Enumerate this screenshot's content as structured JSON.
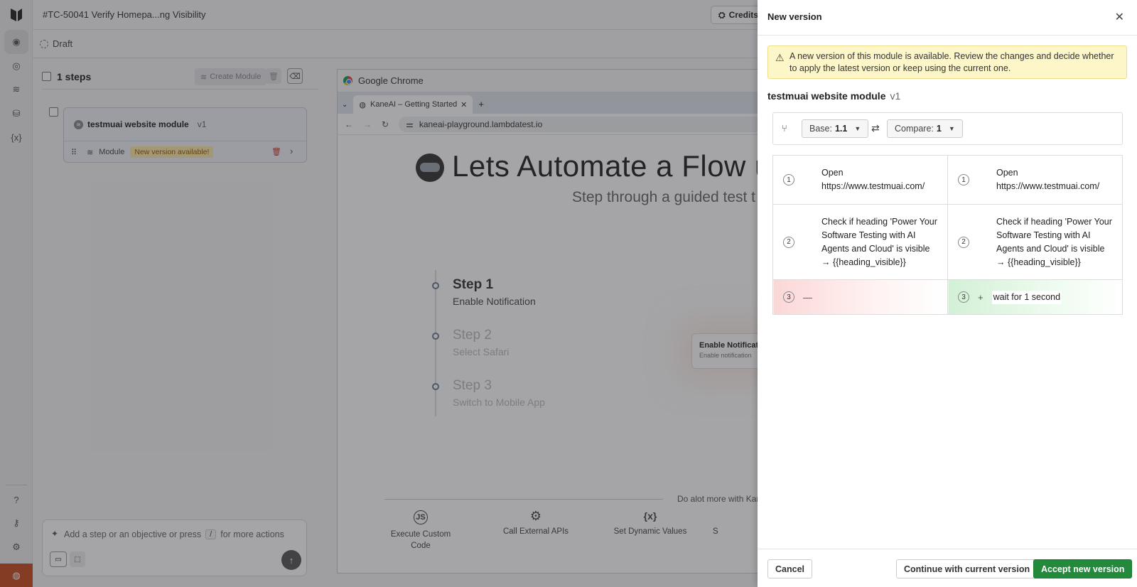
{
  "topbar": {
    "title": "#TC-50041 Verify Homepa...ng Visibility",
    "credits_label": "Credits :"
  },
  "subbar": {
    "status": "Draft"
  },
  "steps": {
    "count_label": "1 steps",
    "create_module": "Create Module",
    "module": {
      "name": "testmuai website module",
      "version": "v1",
      "type": "Module",
      "badge": "New version available!"
    }
  },
  "prompt": {
    "placeholder_pre": "Add a step or an objective or press",
    "key": "/",
    "placeholder_post": "for more actions"
  },
  "browser": {
    "app_name": "Google Chrome",
    "tab_title": "KaneAI – Getting Started",
    "url": "kaneai-playground.lambdatest.io",
    "hero": "Lets Automate a Flow us",
    "subtitle": "Step through a guided test t",
    "steps": [
      {
        "title": "Step 1",
        "desc": "Enable Notification"
      },
      {
        "title": "Step 2",
        "desc": "Select Safari"
      },
      {
        "title": "Step 3",
        "desc": "Switch to Mobile App"
      }
    ],
    "notification": {
      "title": "Enable Notificat",
      "desc": "Enable notification"
    },
    "more": "Do alot more with Kane",
    "features": [
      {
        "icon": "js-icon",
        "glyph": "JS",
        "label": "Execute Custom Code"
      },
      {
        "icon": "gear-icon",
        "glyph": "⚙",
        "label": "Call External APIs"
      },
      {
        "icon": "variable-icon",
        "glyph": "{x}",
        "label": "Set Dynamic Values"
      },
      {
        "icon": "cut-icon",
        "glyph": "",
        "label": "S"
      }
    ]
  },
  "drawer": {
    "title": "New version",
    "alert": "A new version of this module is available. Review the changes and decide whether to apply the latest version or keep using the current one.",
    "module_name": "testmuai website module",
    "module_version": "v1",
    "base_label": "Base:",
    "base_value": "1.1",
    "compare_label": "Compare:",
    "compare_value": "1",
    "rows": [
      {
        "left_num": "1",
        "left": "Open https://www.testmuai.com/",
        "right_num": "1",
        "right": "Open https://www.testmuai.com/"
      },
      {
        "left_num": "2",
        "left": "Check if heading 'Power Your Software Testing with AI Agents and Cloud' is visible → {{heading_visible}}",
        "right_num": "2",
        "right": "Check if heading 'Power Your Software Testing with AI Agents and Cloud' is visible → {{heading_visible}}"
      },
      {
        "left_num": "3",
        "left": "",
        "right_num": "3",
        "right": "wait for 1 second"
      }
    ],
    "cancel": "Cancel",
    "continue": "Continue with current version",
    "accept": "Accept new version"
  }
}
